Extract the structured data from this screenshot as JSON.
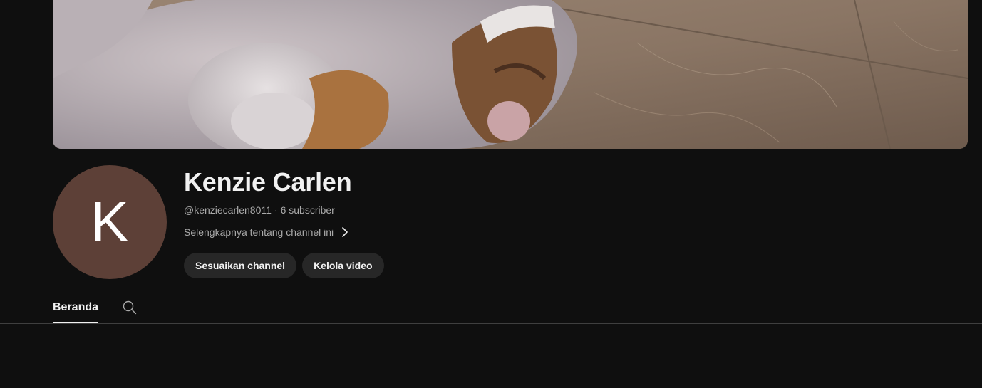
{
  "channel": {
    "avatar_letter": "K",
    "avatar_color": "#5d4037",
    "name": "Kenzie Carlen",
    "handle": "@kenziecarlen8011",
    "separator": "·",
    "subscribers": "6 subscriber",
    "about_link": "Selengkapnya tentang channel ini"
  },
  "actions": {
    "customize_label": "Sesuaikan channel",
    "manage_label": "Kelola video"
  },
  "tabs": [
    {
      "label": "Beranda",
      "active": true
    }
  ],
  "icons": {
    "about": "chevron-right-icon",
    "tab_search": "search-icon"
  },
  "colors": {
    "background": "#0f0f0f",
    "pill": "#272727",
    "text_primary": "#f1f1f1",
    "text_secondary": "#aaaaaa"
  }
}
